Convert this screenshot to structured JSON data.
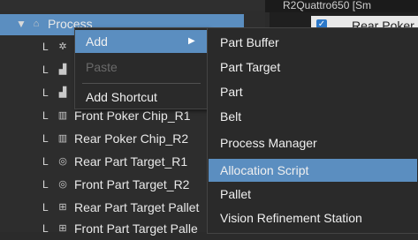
{
  "tree": {
    "items": [
      {
        "label": "Process",
        "icon": "folder-icon"
      },
      {
        "label": "",
        "icon": "gear-icon"
      },
      {
        "label": "",
        "icon": "robot-icon"
      },
      {
        "label": "",
        "icon": "robot-icon"
      },
      {
        "label": "Front Poker Chip_R1",
        "icon": "part-icon"
      },
      {
        "label": "Rear Poker Chip_R2",
        "icon": "part-icon"
      },
      {
        "label": "Rear Part Target_R1",
        "icon": "target-icon"
      },
      {
        "label": "Front Part Target_R2",
        "icon": "target-icon"
      },
      {
        "label": "Rear Part Target Pallet",
        "icon": "pallet-icon"
      },
      {
        "label": "Front Part Target Palle",
        "icon": "pallet-icon"
      }
    ]
  },
  "right_panel": {
    "header": "R2Quattro650 [Sm",
    "row_label": "Rear Poker"
  },
  "context_menu": {
    "add": "Add",
    "paste": "Paste",
    "add_shortcut": "Add Shortcut"
  },
  "submenu": {
    "items": [
      "Part Buffer",
      "Part Target",
      "Part",
      "Belt",
      "Process Manager",
      "Allocation Script",
      "Pallet",
      "Vision Refinement Station"
    ],
    "highlighted": "Allocation Script"
  },
  "colors": {
    "highlight": "#5b8ec0",
    "background": "#2b2b2b"
  }
}
